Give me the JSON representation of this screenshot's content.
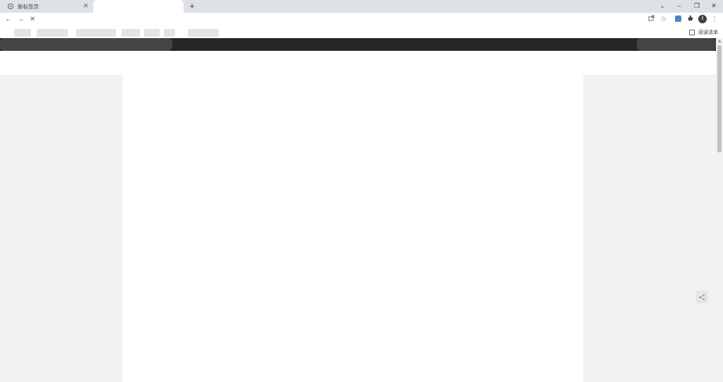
{
  "browser": {
    "tabs": [
      {
        "title": "新标签页",
        "icon": "chrome-icon"
      },
      {
        "title": "",
        "icon": ""
      }
    ],
    "window_controls": {
      "menu": "⌄",
      "minimize": "–",
      "restore": "❐",
      "close": "✕"
    },
    "toolbar": {
      "back": "←",
      "forward": "→",
      "stop": "✕",
      "address": "",
      "profile_initial": "I"
    },
    "bookmarks": {
      "reading_list": "阅读清单"
    }
  },
  "colors": {
    "tabstrip": "#dee1e6",
    "site_header": "#262626",
    "page_background": "#f2f2f2",
    "content_column": "#ffffff",
    "scroll_thumb": "#c1c1c1"
  }
}
